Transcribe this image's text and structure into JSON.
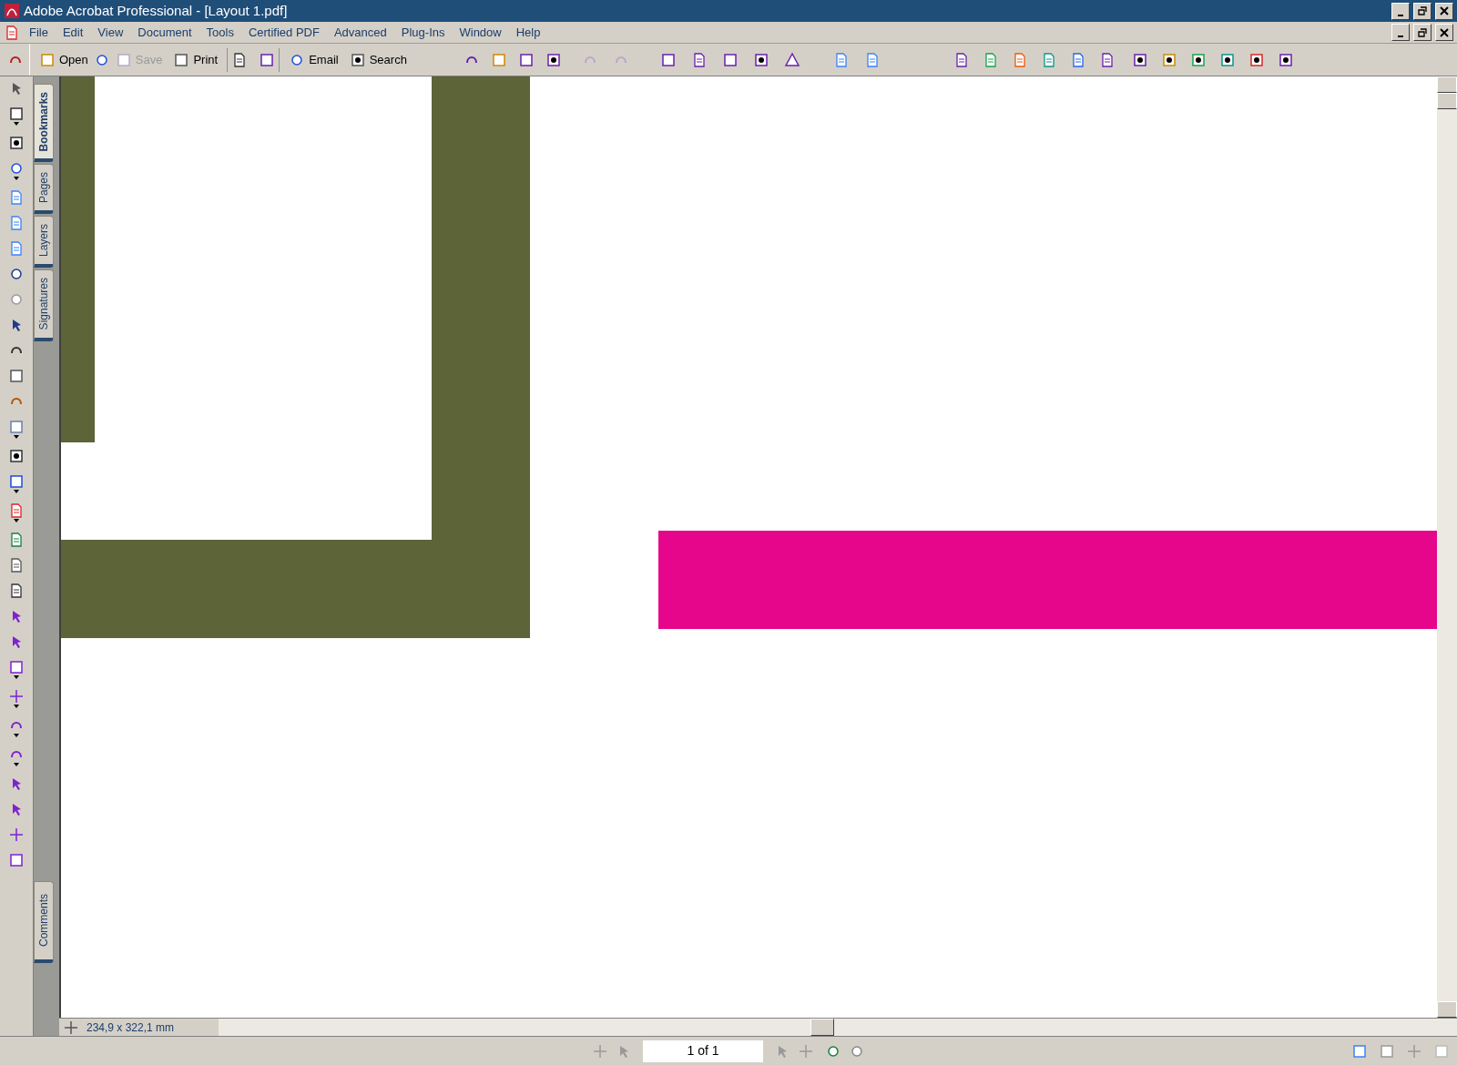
{
  "window": {
    "title": "Adobe Acrobat Professional - [Layout 1.pdf]"
  },
  "menu": [
    {
      "label": "File"
    },
    {
      "label": "Edit"
    },
    {
      "label": "View"
    },
    {
      "label": "Document"
    },
    {
      "label": "Tools"
    },
    {
      "label": "Certified PDF"
    },
    {
      "label": "Advanced"
    },
    {
      "label": "Plug-Ins"
    },
    {
      "label": "Window"
    },
    {
      "label": "Help"
    }
  ],
  "toolbar": [
    {
      "label": "Open",
      "disabled": false
    },
    {
      "label": "Save",
      "disabled": true
    },
    {
      "label": "Print",
      "disabled": false
    },
    {
      "label": "Email",
      "disabled": false
    },
    {
      "label": "Search",
      "disabled": false
    }
  ],
  "side_tabs": [
    {
      "label": "Bookmarks",
      "selected": true
    },
    {
      "label": "Pages",
      "selected": false
    },
    {
      "label": "Layers",
      "selected": false
    },
    {
      "label": "Signatures",
      "selected": false
    }
  ],
  "bottom_tabs": [
    {
      "label": "Comments",
      "selected": false
    }
  ],
  "status": {
    "page_size": "234,9 x 322,1 mm",
    "page": "1 of 1"
  }
}
